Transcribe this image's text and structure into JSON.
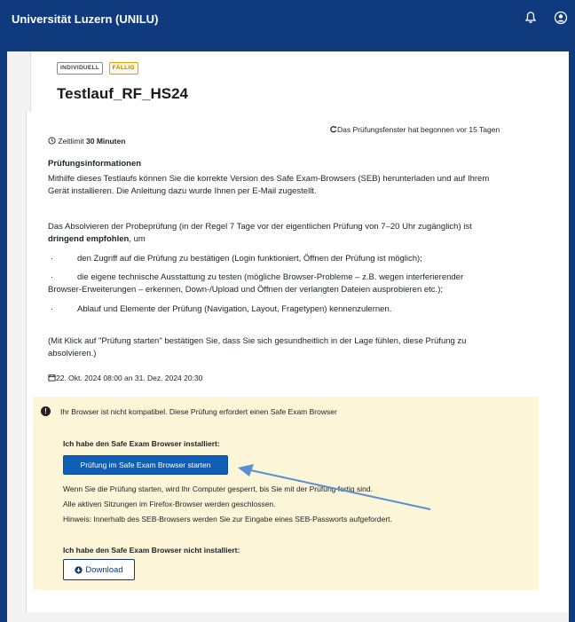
{
  "topbar": {
    "title": "Universität Luzern (UNILU)",
    "icons": [
      "bell-icon",
      "user-icon"
    ]
  },
  "header": {
    "badge_individual": "INDIVIDUELL",
    "badge_due": "FÄLLIG",
    "title": "Testlauf_RF_HS24"
  },
  "content": {
    "window_status": "Das Prüfungsfenster hat begonnen vor 15 Tagen",
    "time_limit_label": "Zeitlimit",
    "time_limit_value": "30 Minuten",
    "info_heading": "Prüfungsinformationen",
    "para1_line1": "Mithilfe dieses Testlaufs können Sie die korrekte Version des Safe Exam-Browsers (SEB) herunterladen und auf Ihrem",
    "para1_line2": "Gerät installieren. Die Anleitung dazu wurde Ihnen per E-Mail zugestellt.",
    "para2_line1": "Das Absolvieren der Probeprüfung (in der Regel 7 Tage vor der eigentlichen Prüfung von 7–20 Uhr zugänglich) ist",
    "para2_bold": "dringend empfohlen",
    "para2_rest": ", um",
    "bullet1": "den Zugriff auf die Prüfung zu bestätigen (Login funktioniert, Öffnen der Prüfung ist möglich);",
    "bullet2_line1": "die eigene technische Ausstattung zu testen (mögliche Browser-Probleme – z.B. wegen interferierender",
    "bullet2_line2": "Browser-Erweiterungen – erkennen, Down-/Upload und Öffnen der verlangten Dateien ausprobieren etc.);",
    "bullet3": "Ablauf und Elemente der Prüfung (Navigation, Layout, Fragetypen) kennenzulernen.",
    "para3_line1": "(Mit Klick auf \"Prüfung starten\" bestätigen Sie, dass Sie sich gesundheitlich in der Lage fühlen, diese Prüfung zu",
    "para3_line2": "absolvieren.)",
    "date_range": "22. Okt. 2024 08:00 an 31. Dez. 2024 20:30"
  },
  "alert": {
    "warning": "Ihr Browser ist nicht kompatibel. Diese Prüfung erfordert einen Safe Exam Browser",
    "installed_heading": "Ich habe den Safe Exam Browser installiert:",
    "start_button": "Prüfung im Safe Exam Browser starten",
    "note1": "Wenn Sie die Prüfung starten, wird Ihr Computer gesperrt, bis Sie mit der Prüfung fertig sind.",
    "note2": "Alle aktiven Sitzungen im Firefox-Browser werden geschlossen.",
    "note3": "Hinweis: Innerhalb des SEB-Browsers werden Sie zur Eingabe eines SEB-Passworts aufgefordert.",
    "not_installed_heading": "Ich habe den Safe Exam Browser nicht installiert:",
    "download_button": "Download"
  },
  "colors": {
    "brand": "#0f3b7e",
    "primary_button": "#0f5fb6",
    "alert_bg": "#fdf5d7",
    "annotation_arrow": "#5b8fd0"
  }
}
